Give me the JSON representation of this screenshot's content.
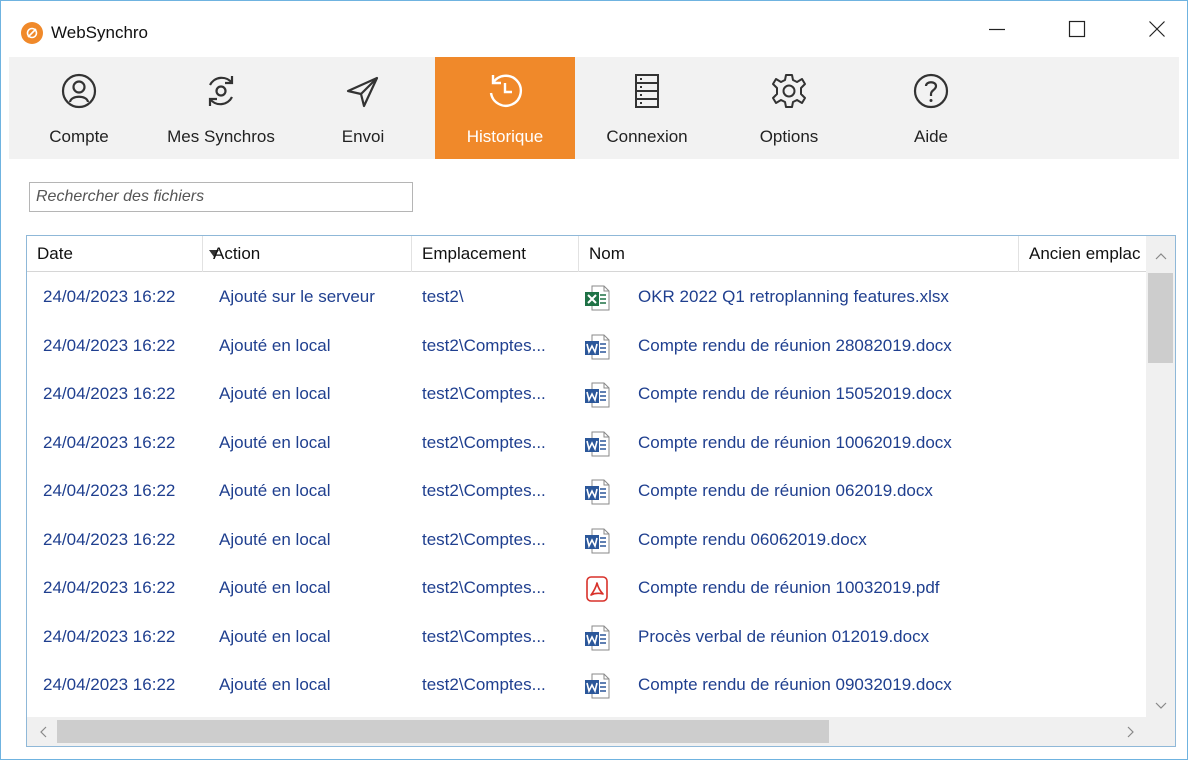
{
  "window": {
    "title": "WebSynchro",
    "accent": "#f0892a"
  },
  "toolbar": {
    "items": [
      {
        "label": "Compte",
        "icon": "user-circle-icon",
        "active": false
      },
      {
        "label": "Mes Synchros",
        "icon": "sync-icon",
        "active": false
      },
      {
        "label": "Envoi",
        "icon": "paper-plane-icon",
        "active": false
      },
      {
        "label": "Historique",
        "icon": "history-icon",
        "active": true
      },
      {
        "label": "Connexion",
        "icon": "server-icon",
        "active": false
      },
      {
        "label": "Options",
        "icon": "gear-icon",
        "active": false
      },
      {
        "label": "Aide",
        "icon": "help-icon",
        "active": false
      }
    ]
  },
  "search": {
    "placeholder": "Rechercher des fichiers",
    "value": ""
  },
  "table": {
    "columns": [
      "Date",
      "Action",
      "Emplacement",
      "Nom",
      "Ancien emplac"
    ],
    "sorted_column": "Date",
    "rows": [
      {
        "date": "24/04/2023 16:22",
        "action": "Ajouté sur le serveur",
        "emplacement": "test2\\",
        "type": "xlsx",
        "nom": "OKR 2022 Q1 retroplanning features.xlsx"
      },
      {
        "date": "24/04/2023 16:22",
        "action": "Ajouté en local",
        "emplacement": "test2\\Comptes...",
        "type": "docx",
        "nom": "Compte rendu de réunion 28082019.docx"
      },
      {
        "date": "24/04/2023 16:22",
        "action": "Ajouté en local",
        "emplacement": "test2\\Comptes...",
        "type": "docx",
        "nom": "Compte rendu de réunion 15052019.docx"
      },
      {
        "date": "24/04/2023 16:22",
        "action": "Ajouté en local",
        "emplacement": "test2\\Comptes...",
        "type": "docx",
        "nom": "Compte rendu de réunion 10062019.docx"
      },
      {
        "date": "24/04/2023 16:22",
        "action": "Ajouté en local",
        "emplacement": "test2\\Comptes...",
        "type": "docx",
        "nom": "Compte rendu de réunion 062019.docx"
      },
      {
        "date": "24/04/2023 16:22",
        "action": "Ajouté en local",
        "emplacement": "test2\\Comptes...",
        "type": "docx",
        "nom": "Compte rendu 06062019.docx"
      },
      {
        "date": "24/04/2023 16:22",
        "action": "Ajouté en local",
        "emplacement": "test2\\Comptes...",
        "type": "pdf",
        "nom": "Compte rendu de réunion 10032019.pdf"
      },
      {
        "date": "24/04/2023 16:22",
        "action": "Ajouté en local",
        "emplacement": "test2\\Comptes...",
        "type": "docx",
        "nom": "Procès verbal de réunion 012019.docx"
      },
      {
        "date": "24/04/2023 16:22",
        "action": "Ajouté en local",
        "emplacement": "test2\\Comptes...",
        "type": "docx",
        "nom": "Compte rendu de réunion 09032019.docx"
      }
    ]
  }
}
